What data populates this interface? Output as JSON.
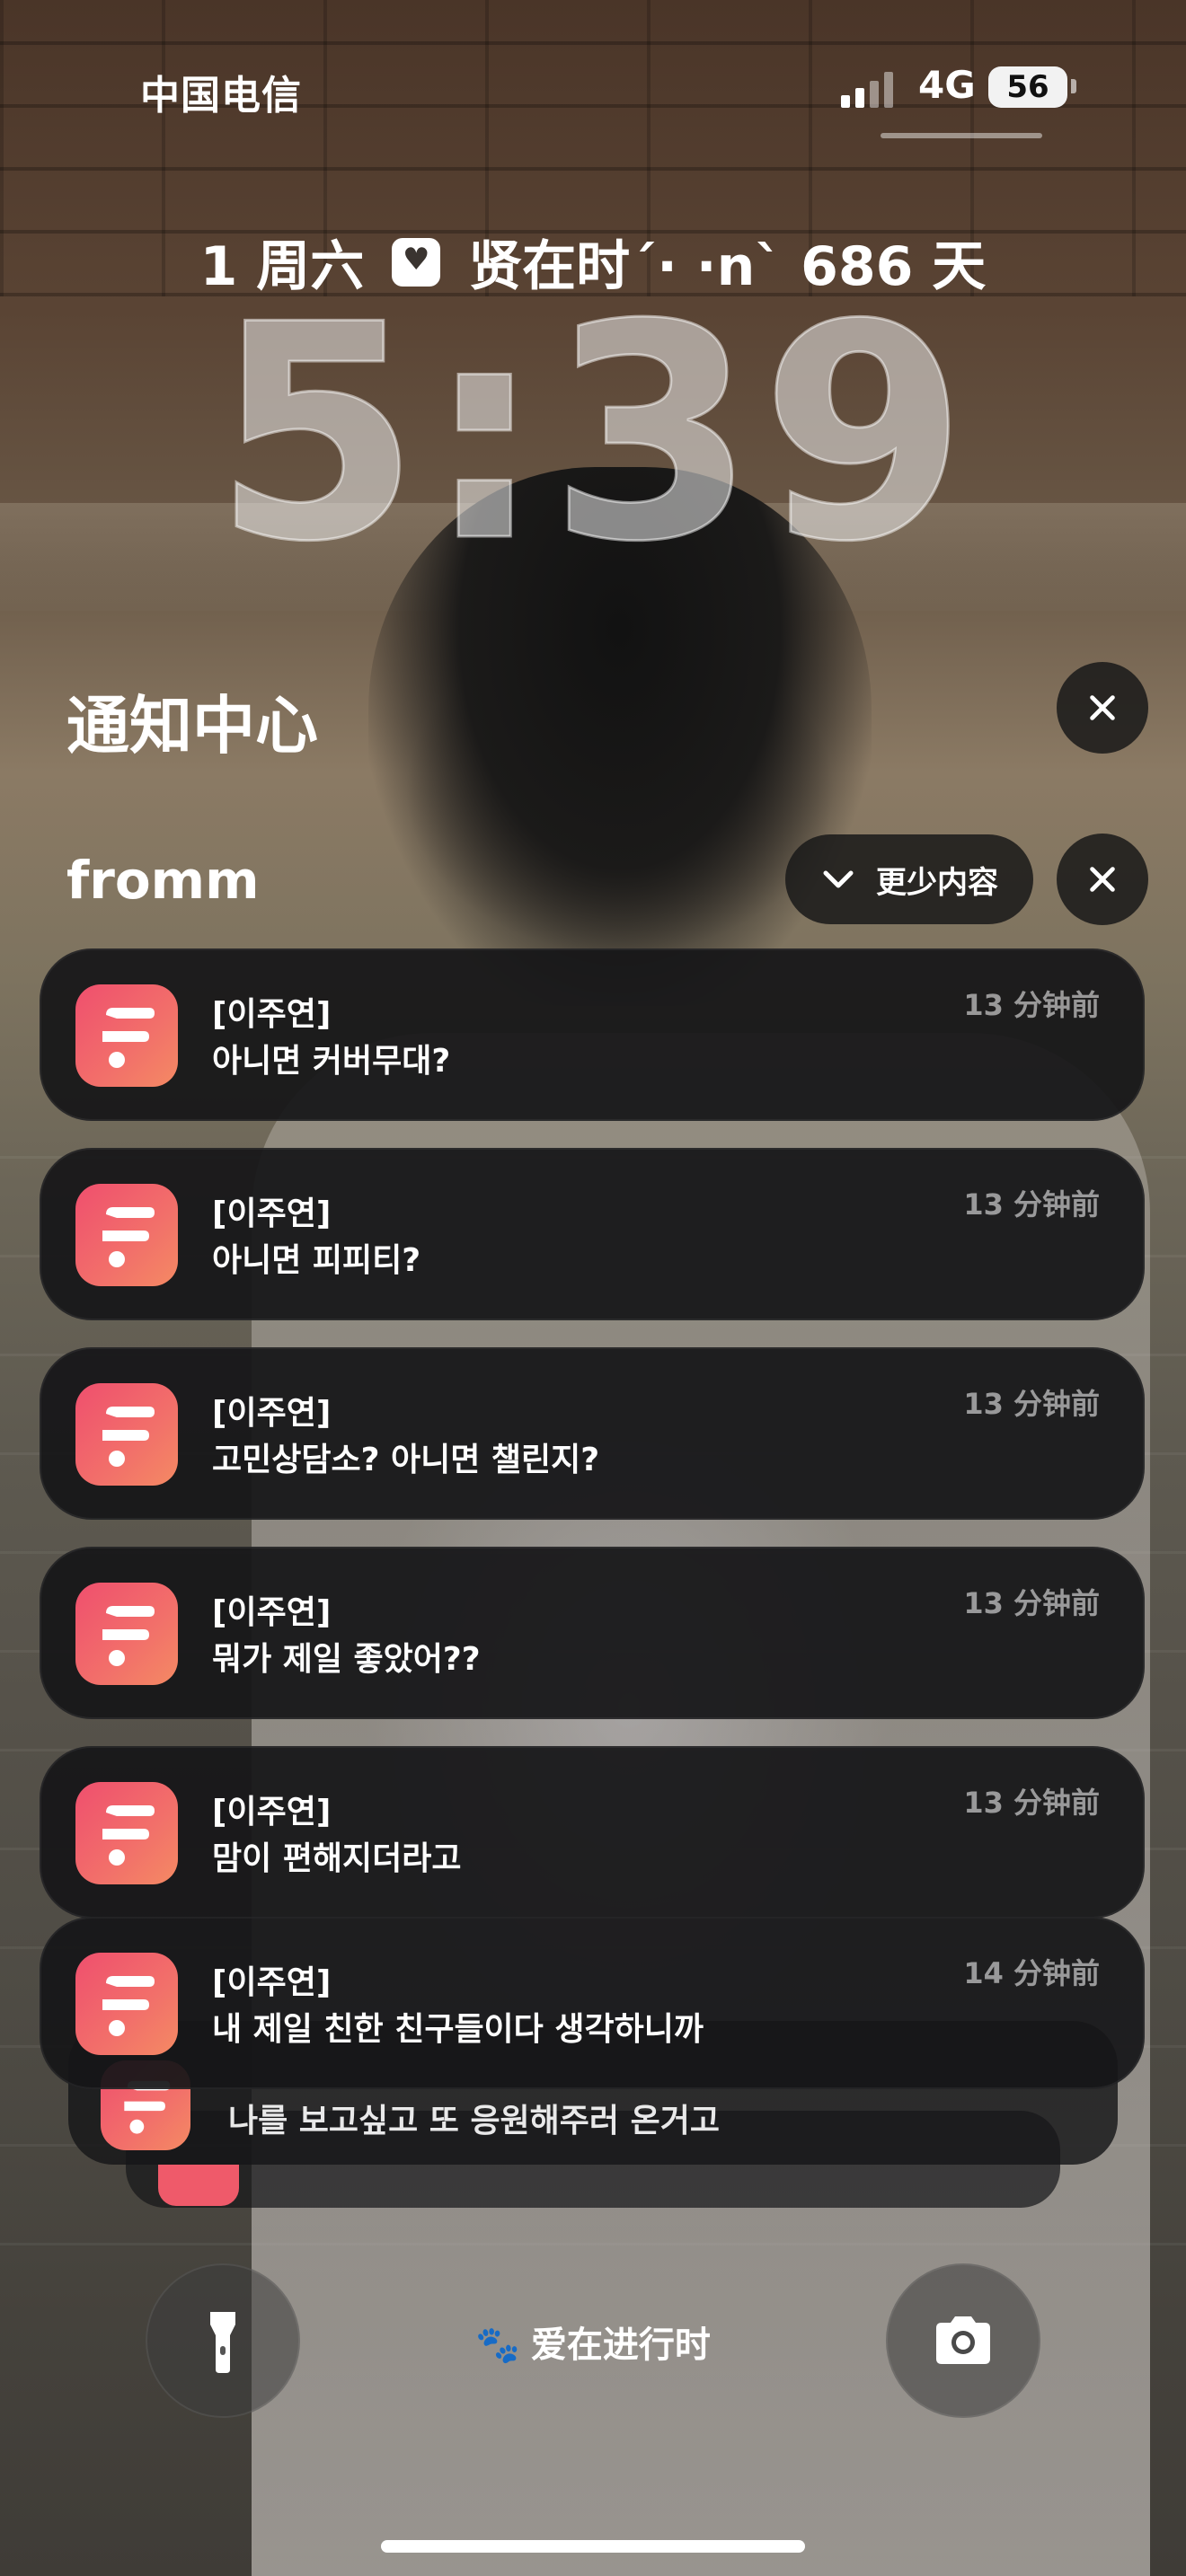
{
  "status_bar": {
    "carrier": "中国电信",
    "network": "4G",
    "battery": "56",
    "icons": [
      "signal-bars-icon",
      "battery-icon"
    ]
  },
  "lock_screen": {
    "date_prefix": "1 周六",
    "widget_text": "贤在时´· ·n` 686 天",
    "widget_icon": "calendar-heart-icon",
    "clock": "5:39"
  },
  "notification_center": {
    "title": "通知中心",
    "clear_icon": "close-icon",
    "group": {
      "app_name": "fromm",
      "collapse_label": "更少内容",
      "collapse_icon": "chevron-down-icon",
      "dismiss_icon": "close-icon"
    },
    "notifications": [
      {
        "title": "[이주연]",
        "body": " 아니면 커버무대?",
        "time": "13 分钟前"
      },
      {
        "title": "[이주연]",
        "body": "아니면 피피티?",
        "time": "13 分钟前"
      },
      {
        "title": "[이주연]",
        "body": "고민상담소? 아니면 챌린지?",
        "time": "13 分钟前"
      },
      {
        "title": "[이주연]",
        "body": "뭐가 제일 좋았어??",
        "time": "13 分钟前"
      },
      {
        "title": "[이주연]",
        "body": "맘이 편해지더라고",
        "time": "13 分钟前"
      },
      {
        "title": "[이주연]",
        "body": "내 제일 친한 친구들이다 생각하니까",
        "time": "14 分钟前"
      }
    ],
    "stacked_preview": {
      "body": "나를 보고싶고 또 응원해주러 온거고"
    }
  },
  "bottom_controls": {
    "flashlight_icon": "flashlight-icon",
    "camera_icon": "camera-icon",
    "focus_label": "爱在进行时",
    "focus_icon": "paw-icon"
  }
}
